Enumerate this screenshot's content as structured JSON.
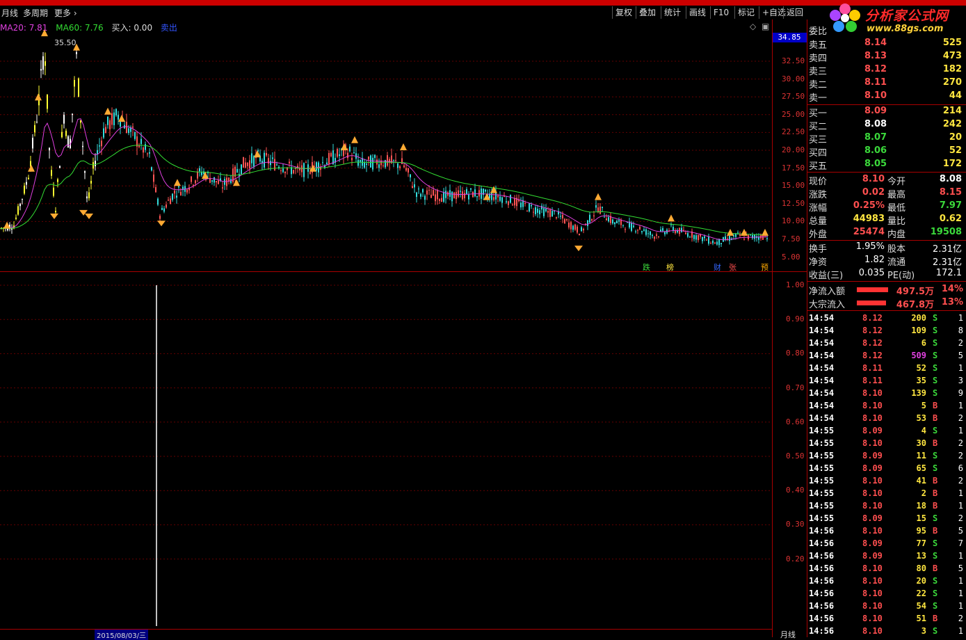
{
  "menu": {
    "monthly": "月线",
    "multi_period": "多周期",
    "more": "更多",
    "buttons": [
      "复权",
      "叠加",
      "统计",
      "画线",
      "F10",
      "标记",
      "+自选",
      "返回"
    ]
  },
  "logo": {
    "title": "分析家公式网",
    "url": "www.88gs.com"
  },
  "indicators": {
    "ma20": "MA20: 7.81",
    "ma60": "MA60: 7.76",
    "buy": "买入: 0.00",
    "sell": "卖出"
  },
  "main_chart": {
    "y_ticks": [
      "32.50",
      "30.00",
      "27.50",
      "25.00",
      "22.50",
      "20.00",
      "17.50",
      "15.00",
      "12.50",
      "10.00",
      "7.50",
      "5.00"
    ],
    "peak_label": "35.50",
    "current_box": "34.85",
    "markers": [
      "跌",
      "榜",
      "财",
      "张",
      "预"
    ]
  },
  "sub_chart": {
    "y_ticks": [
      "1.00",
      "0.90",
      "0.80",
      "0.70",
      "0.60",
      "0.50",
      "0.40",
      "0.30",
      "0.20"
    ],
    "date_label": "2015/08/03/三",
    "period_label": "月线"
  },
  "colors": {
    "up": "#ff4f4f",
    "down": "#3bd93b",
    "ma20": "#e040e0",
    "ma60": "#33dd33",
    "grid": "#700000"
  },
  "order_book": {
    "header": "委比",
    "asks": [
      {
        "label": "卖五",
        "price": "8.14",
        "vol": "525"
      },
      {
        "label": "卖四",
        "price": "8.13",
        "vol": "473"
      },
      {
        "label": "卖三",
        "price": "8.12",
        "vol": "182"
      },
      {
        "label": "卖二",
        "price": "8.11",
        "vol": "270"
      },
      {
        "label": "卖一",
        "price": "8.10",
        "vol": "44"
      }
    ],
    "bids": [
      {
        "label": "买一",
        "price": "8.09",
        "vol": "214"
      },
      {
        "label": "买二",
        "price": "8.08",
        "vol": "242"
      },
      {
        "label": "买三",
        "price": "8.07",
        "vol": "20"
      },
      {
        "label": "买四",
        "price": "8.06",
        "vol": "52"
      },
      {
        "label": "买五",
        "price": "8.05",
        "vol": "172"
      }
    ]
  },
  "quote": [
    {
      "l1": "现价",
      "v1": "8.10",
      "l2": "今开",
      "v2": "8.08"
    },
    {
      "l1": "涨跌",
      "v1": "0.02",
      "l2": "最高",
      "v2": "8.15"
    },
    {
      "l1": "涨幅",
      "v1": "0.25%",
      "l2": "最低",
      "v2": "7.97"
    },
    {
      "l1": "总量",
      "v1": "44983",
      "l2": "量比",
      "v2": "0.62"
    },
    {
      "l1": "外盘",
      "v1": "25474",
      "l2": "内盘",
      "v2": "19508"
    }
  ],
  "stats": [
    {
      "l1": "换手",
      "v1": "1.95%",
      "l2": "股本",
      "v2": "2.31亿"
    },
    {
      "l1": "净资",
      "v1": "1.82",
      "l2": "流通",
      "v2": "2.31亿"
    },
    {
      "l1": "收益(三)",
      "v1": "0.035",
      "l2": "PE(动)",
      "v2": "172.1"
    }
  ],
  "flows": [
    {
      "label": "净流入额",
      "value": "497.5万",
      "pct": "14%"
    },
    {
      "label": "大宗流入",
      "value": "467.8万",
      "pct": "13%"
    }
  ],
  "ticks": [
    [
      "14:54",
      "8.12",
      "200",
      "S",
      "1"
    ],
    [
      "14:54",
      "8.12",
      "109",
      "S",
      "8"
    ],
    [
      "14:54",
      "8.12",
      "6",
      "S",
      "2"
    ],
    [
      "14:54",
      "8.12",
      "509",
      "S",
      "5"
    ],
    [
      "14:54",
      "8.11",
      "52",
      "S",
      "1"
    ],
    [
      "14:54",
      "8.11",
      "35",
      "S",
      "3"
    ],
    [
      "14:54",
      "8.10",
      "139",
      "S",
      "9"
    ],
    [
      "14:54",
      "8.10",
      "5",
      "B",
      "1"
    ],
    [
      "14:54",
      "8.10",
      "53",
      "B",
      "2"
    ],
    [
      "14:55",
      "8.09",
      "4",
      "S",
      "1"
    ],
    [
      "14:55",
      "8.10",
      "30",
      "B",
      "2"
    ],
    [
      "14:55",
      "8.09",
      "11",
      "S",
      "2"
    ],
    [
      "14:55",
      "8.09",
      "65",
      "S",
      "6"
    ],
    [
      "14:55",
      "8.10",
      "41",
      "B",
      "2"
    ],
    [
      "14:55",
      "8.10",
      "2",
      "B",
      "1"
    ],
    [
      "14:55",
      "8.10",
      "18",
      "B",
      "1"
    ],
    [
      "14:55",
      "8.09",
      "15",
      "S",
      "2"
    ],
    [
      "14:56",
      "8.10",
      "95",
      "B",
      "5"
    ],
    [
      "14:56",
      "8.09",
      "77",
      "S",
      "7"
    ],
    [
      "14:56",
      "8.09",
      "13",
      "S",
      "1"
    ],
    [
      "14:56",
      "8.10",
      "80",
      "B",
      "5"
    ],
    [
      "14:56",
      "8.10",
      "20",
      "S",
      "1"
    ],
    [
      "14:56",
      "8.10",
      "22",
      "S",
      "1"
    ],
    [
      "14:56",
      "8.10",
      "54",
      "S",
      "1"
    ],
    [
      "14:56",
      "8.10",
      "51",
      "B",
      "2"
    ],
    [
      "14:56",
      "8.10",
      "3",
      "S",
      "1"
    ]
  ]
}
